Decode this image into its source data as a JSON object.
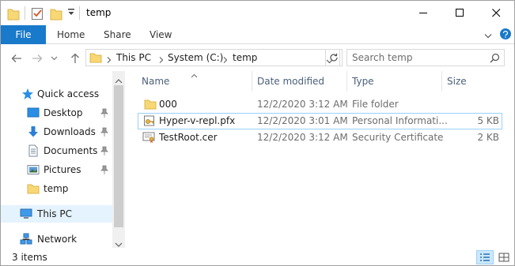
{
  "window": {
    "title": "temp"
  },
  "ribbon": {
    "tabs": [
      "File",
      "Home",
      "Share",
      "View"
    ]
  },
  "address": {
    "segments": [
      "This PC",
      "System (C:)",
      "temp"
    ]
  },
  "search": {
    "placeholder": "Search temp"
  },
  "navpane": {
    "items": [
      {
        "label": "Quick access",
        "icon": "star-icon"
      },
      {
        "label": "Desktop",
        "icon": "desktop-icon",
        "pinned": true
      },
      {
        "label": "Downloads",
        "icon": "download-icon",
        "pinned": true
      },
      {
        "label": "Documents",
        "icon": "documents-icon",
        "pinned": true
      },
      {
        "label": "Pictures",
        "icon": "pictures-icon",
        "pinned": true
      },
      {
        "label": "temp",
        "icon": "folder-icon"
      },
      {
        "label": "This PC",
        "icon": "computer-icon",
        "selected": true
      },
      {
        "label": "Network",
        "icon": "network-icon"
      }
    ]
  },
  "columns": {
    "name": "Name",
    "date": "Date modified",
    "type": "Type",
    "size": "Size"
  },
  "files": [
    {
      "name": "000",
      "date": "12/2/2020 3:12 AM",
      "type": "File folder",
      "size": "",
      "icon": "folder-icon"
    },
    {
      "name": "Hyper-v-repl.pfx",
      "date": "12/2/2020 3:01 AM",
      "type": "Personal Informati...",
      "size": "5 KB",
      "icon": "certificate-key-icon",
      "selected": true
    },
    {
      "name": "TestRoot.cer",
      "date": "12/2/2020 3:12 AM",
      "type": "Security Certificate",
      "size": "2 KB",
      "icon": "certificate-icon"
    }
  ],
  "status": {
    "count": "3 items"
  },
  "colors": {
    "accent": "#1979ca",
    "selection_bg": "#cce8ff",
    "selection_border": "#99d1ff",
    "folder": "#f8d775"
  }
}
